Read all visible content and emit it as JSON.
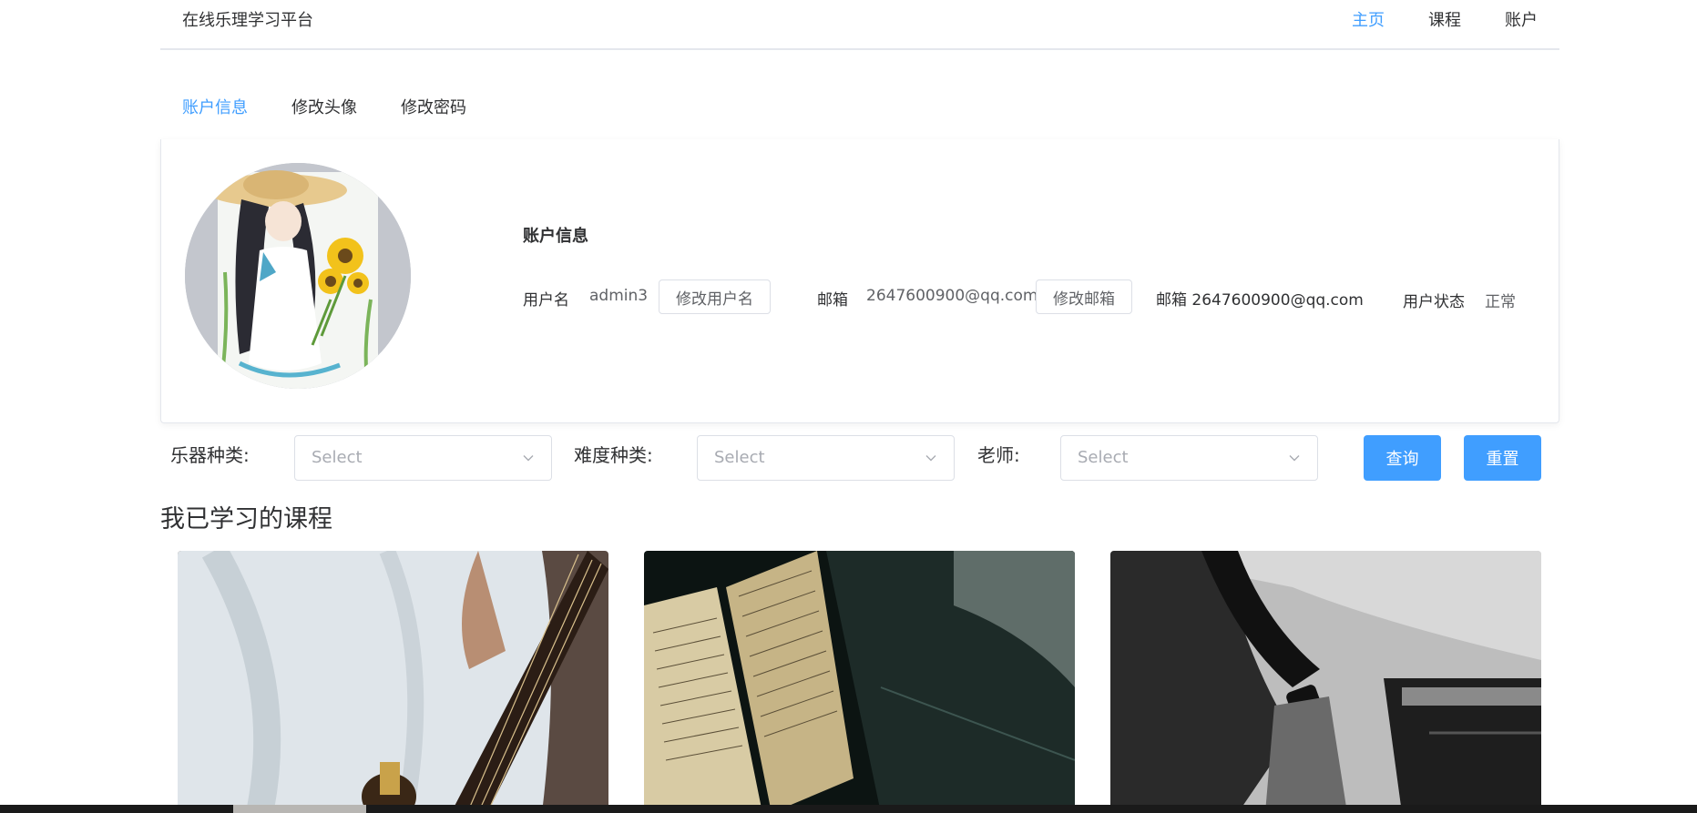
{
  "header": {
    "brand": "在线乐理学习平台",
    "nav": [
      {
        "label": "主页",
        "active": true
      },
      {
        "label": "课程",
        "active": false
      },
      {
        "label": "账户",
        "active": false
      }
    ]
  },
  "tabs": [
    {
      "label": "账户信息",
      "active": true
    },
    {
      "label": "修改头像",
      "active": false
    },
    {
      "label": "修改密码",
      "active": false
    }
  ],
  "account": {
    "title": "账户信息",
    "username_label": "用户名",
    "username": "admin3",
    "edit_username": "修改用户名",
    "email_label": "邮箱",
    "email": "2647600900@qq.com",
    "edit_email": "修改邮箱",
    "email_combined": "邮箱 2647600900@qq.com",
    "status_label": "用户状态",
    "status": "正常"
  },
  "filters": {
    "instrument_label": "乐器种类:",
    "difficulty_label": "难度种类:",
    "teacher_label": "老师:",
    "placeholder": "Select",
    "search_button": "查询",
    "reset_button": "重置"
  },
  "courses_section": {
    "title": "我已学习的课程"
  },
  "colors": {
    "primary": "#409eff",
    "text": "#303133",
    "border": "#dcdfe6",
    "placeholder": "#a8abb2"
  }
}
